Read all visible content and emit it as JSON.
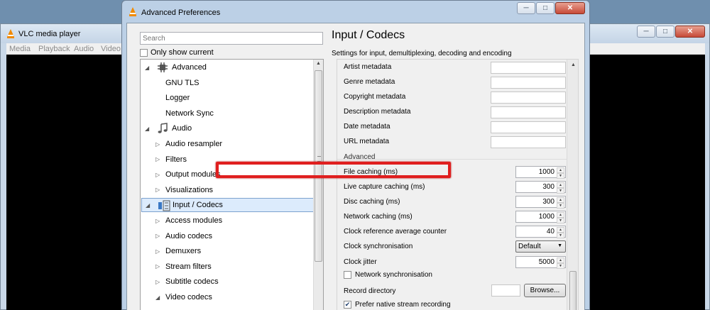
{
  "main_window": {
    "title": "VLC media player",
    "menu": [
      "Media",
      "Playback",
      "Audio",
      "Video"
    ]
  },
  "dialog": {
    "title": "Advanced Preferences",
    "search_placeholder": "Search",
    "only_show_current": "Only show current",
    "only_show_current_checked": false
  },
  "tree": [
    {
      "label": "Advanced",
      "level": 0,
      "expanded": true,
      "icon": "chip-icon"
    },
    {
      "label": "GNU TLS",
      "level": 1,
      "expanded": null
    },
    {
      "label": "Logger",
      "level": 1,
      "expanded": null
    },
    {
      "label": "Network Sync",
      "level": 1,
      "expanded": null
    },
    {
      "label": "Audio",
      "level": 0,
      "expanded": true,
      "icon": "music-note-icon"
    },
    {
      "label": "Audio resampler",
      "level": 1,
      "expanded": false
    },
    {
      "label": "Filters",
      "level": 1,
      "expanded": false
    },
    {
      "label": "Output modules",
      "level": 1,
      "expanded": false
    },
    {
      "label": "Visualizations",
      "level": 1,
      "expanded": false
    },
    {
      "label": "Input / Codecs",
      "level": 0,
      "expanded": true,
      "icon": "codec-icon",
      "selected": true
    },
    {
      "label": "Access modules",
      "level": 1,
      "expanded": false
    },
    {
      "label": "Audio codecs",
      "level": 1,
      "expanded": false
    },
    {
      "label": "Demuxers",
      "level": 1,
      "expanded": false
    },
    {
      "label": "Stream filters",
      "level": 1,
      "expanded": false
    },
    {
      "label": "Subtitle codecs",
      "level": 1,
      "expanded": false
    },
    {
      "label": "Video codecs",
      "level": 1,
      "expanded": true
    }
  ],
  "panel": {
    "title": "Input / Codecs",
    "description": "Settings for input, demultiplexing, decoding and encoding",
    "metadata_rows": [
      "Artist metadata",
      "Genre metadata",
      "Copyright metadata",
      "Description metadata",
      "Date metadata",
      "URL metadata"
    ],
    "group_advanced": "Advanced",
    "numeric_rows": [
      {
        "label": "File caching (ms)",
        "value": "1000",
        "highlighted": true
      },
      {
        "label": "Live capture caching (ms)",
        "value": "300"
      },
      {
        "label": "Disc caching (ms)",
        "value": "300"
      },
      {
        "label": "Network caching (ms)",
        "value": "1000"
      },
      {
        "label": "Clock reference average counter",
        "value": "40"
      }
    ],
    "clock_sync_label": "Clock synchronisation",
    "clock_sync_value": "Default",
    "clock_jitter_label": "Clock jitter",
    "clock_jitter_value": "5000",
    "network_sync_label": "Network synchronisation",
    "network_sync_checked": false,
    "record_dir_label": "Record directory",
    "browse_label": "Browse...",
    "prefer_native_label": "Prefer native stream recording",
    "prefer_native_checked": true
  },
  "colors": {
    "highlight": "#e01e1e",
    "selection": "#dcebfc",
    "vlc_orange": "#f08a00"
  }
}
